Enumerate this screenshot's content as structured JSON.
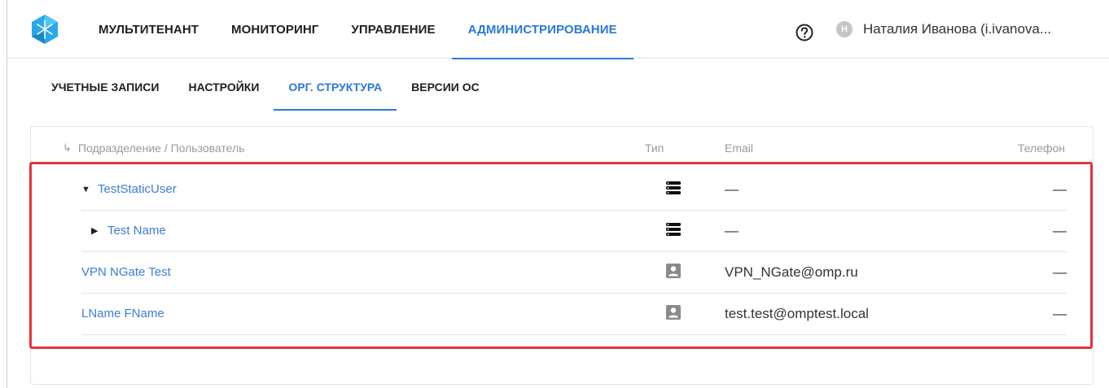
{
  "top_nav": {
    "tabs": [
      {
        "label": "МУЛЬТИТЕНАНТ",
        "active": false
      },
      {
        "label": "МОНИТОРИНГ",
        "active": false
      },
      {
        "label": "УПРАВЛЕНИЕ",
        "active": false
      },
      {
        "label": "АДМИНИСТРИРОВАНИЕ",
        "active": true
      }
    ],
    "help_icon": "question-circle-icon",
    "user": {
      "avatar_letter": "Н",
      "name": "Наталия Иванова (i.ivanova..."
    }
  },
  "sub_nav": {
    "tabs": [
      {
        "label": "УЧЕТНЫЕ ЗАПИСИ",
        "active": false
      },
      {
        "label": "НАСТРОЙКИ",
        "active": false
      },
      {
        "label": "ОРГ. СТРУКТУРА",
        "active": true
      },
      {
        "label": "ВЕРСИИ ОС",
        "active": false
      }
    ]
  },
  "table": {
    "columns": {
      "name": "Подразделение / Пользователь",
      "type": "Тип",
      "email": "Email",
      "phone": "Телефон"
    },
    "rows": [
      {
        "name": "TestStaticUser",
        "caret": "▼",
        "type_icon": "list-icon",
        "email": "—",
        "phone": "—"
      },
      {
        "name": "Test Name",
        "caret": "▶",
        "type_icon": "list-icon",
        "email": "—",
        "phone": "—"
      },
      {
        "name": "VPN NGate Test",
        "caret": "",
        "type_icon": "user-card-icon",
        "email": "VPN_NGate@omp.ru",
        "phone": "—"
      },
      {
        "name": "LName FName",
        "caret": "",
        "type_icon": "user-card-icon",
        "email": "test.test@omptest.local",
        "phone": "—"
      }
    ]
  },
  "colors": {
    "accent": "#2979d9",
    "link": "#3b7dd8",
    "highlight": "#e8333d"
  }
}
